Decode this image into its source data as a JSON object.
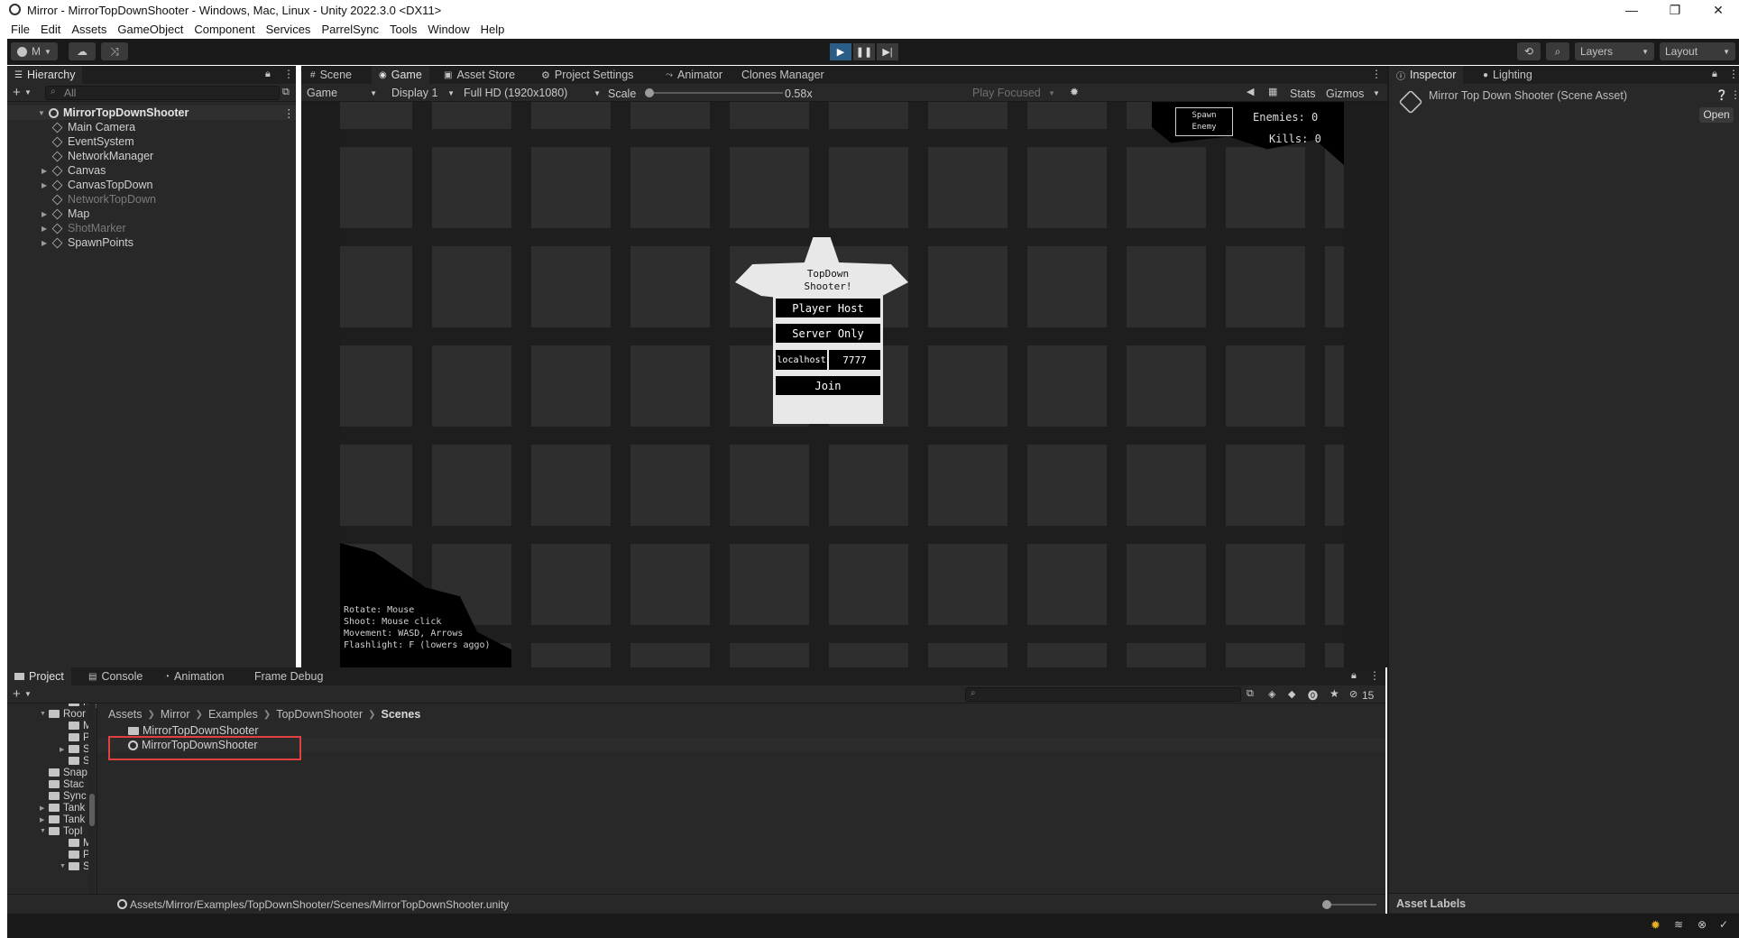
{
  "window": {
    "title": "Mirror - MirrorTopDownShooter - Windows, Mac, Linux - Unity 2022.3.0 <DX11>",
    "minimize": "—",
    "restore": "❐",
    "close": "✕"
  },
  "menu": [
    "File",
    "Edit",
    "Assets",
    "GameObject",
    "Component",
    "Services",
    "ParrelSync",
    "Tools",
    "Window",
    "Help"
  ],
  "toolbar": {
    "account": "M",
    "layers": "Layers",
    "layout": "Layout"
  },
  "hierarchy": {
    "tab": "Hierarchy",
    "search_placeholder": "All",
    "root": "MirrorTopDownShooter",
    "items": [
      {
        "label": "Main Camera",
        "dim": false,
        "arrow": false
      },
      {
        "label": "EventSystem",
        "dim": false,
        "arrow": false
      },
      {
        "label": "NetworkManager",
        "dim": false,
        "arrow": false
      },
      {
        "label": "Canvas",
        "dim": false,
        "arrow": true
      },
      {
        "label": "CanvasTopDown",
        "dim": false,
        "arrow": true
      },
      {
        "label": "NetworkTopDown",
        "dim": true,
        "arrow": false
      },
      {
        "label": "Map",
        "dim": false,
        "arrow": true
      },
      {
        "label": "ShotMarker",
        "dim": true,
        "arrow": true
      },
      {
        "label": "SpawnPoints",
        "dim": false,
        "arrow": true
      }
    ]
  },
  "center_tabs": [
    "Scene",
    "Game",
    "Asset Store",
    "Project Settings",
    "Animator",
    "Clones Manager"
  ],
  "game_bar": {
    "mode": "Game",
    "display": "Display 1",
    "resolution": "Full HD (1920x1080)",
    "scale_label": "Scale",
    "scale_value": "0.58x",
    "play_focused": "Play Focused",
    "stats": "Stats",
    "gizmos": "Gizmos"
  },
  "game": {
    "title_line1": "TopDown",
    "title_line2": "Shooter!",
    "player_host": "Player Host",
    "server_only": "Server Only",
    "address": "localhost",
    "port": "7777",
    "join": "Join",
    "spawn_line1": "Spawn",
    "spawn_line2": "Enemy",
    "enemies": "Enemies: 0",
    "kills": "Kills: 0",
    "help": [
      "Rotate: Mouse",
      "Shoot: Mouse click",
      "Movement: WASD, Arrows",
      "Flashlight: F (lowers aggo)"
    ]
  },
  "inspector": {
    "tabs": [
      "Inspector",
      "Lighting"
    ],
    "asset_title": "Mirror Top Down Shooter (Scene Asset)",
    "open": "Open",
    "asset_labels": "Asset Labels"
  },
  "bottom_tabs": [
    "Project",
    "Console",
    "Animation",
    "Frame Debug"
  ],
  "project": {
    "tree": [
      {
        "label": "Rigi",
        "indent": 3,
        "arrow": false,
        "top": 0
      },
      {
        "label": "Roor",
        "indent": 2,
        "arrow": true,
        "open": true
      },
      {
        "label": "M",
        "indent": 3,
        "arrow": false
      },
      {
        "label": "Pr",
        "indent": 3,
        "arrow": false
      },
      {
        "label": "Sc",
        "indent": 3,
        "arrow": true
      },
      {
        "label": "Sc",
        "indent": 3,
        "arrow": false
      },
      {
        "label": "Snap",
        "indent": 2,
        "arrow": false
      },
      {
        "label": "Stac",
        "indent": 2,
        "arrow": false
      },
      {
        "label": "Sync",
        "indent": 2,
        "arrow": false
      },
      {
        "label": "Tank",
        "indent": 2,
        "arrow": true
      },
      {
        "label": "Tank",
        "indent": 2,
        "arrow": true
      },
      {
        "label": "TopI",
        "indent": 2,
        "arrow": true,
        "open": true
      },
      {
        "label": "M",
        "indent": 3,
        "arrow": false
      },
      {
        "label": "Pr",
        "indent": 3,
        "arrow": false
      },
      {
        "label": "Sc",
        "indent": 3,
        "arrow": true,
        "open": true
      }
    ],
    "breadcrumb": [
      "Assets",
      "Mirror",
      "Examples",
      "TopDownShooter",
      "Scenes"
    ],
    "files": [
      {
        "label": "MirrorTopDownShooter",
        "type": "folder"
      },
      {
        "label": "MirrorTopDownShooter",
        "type": "scene",
        "highlight": true
      }
    ],
    "path": "Assets/Mirror/Examples/TopDownShooter/Scenes/MirrorTopDownShooter.unity",
    "hidden_count": "15"
  },
  "colors": {
    "highlight_box": "#e0413f",
    "panel": "#282828",
    "tabbar": "#1e1e1e"
  }
}
